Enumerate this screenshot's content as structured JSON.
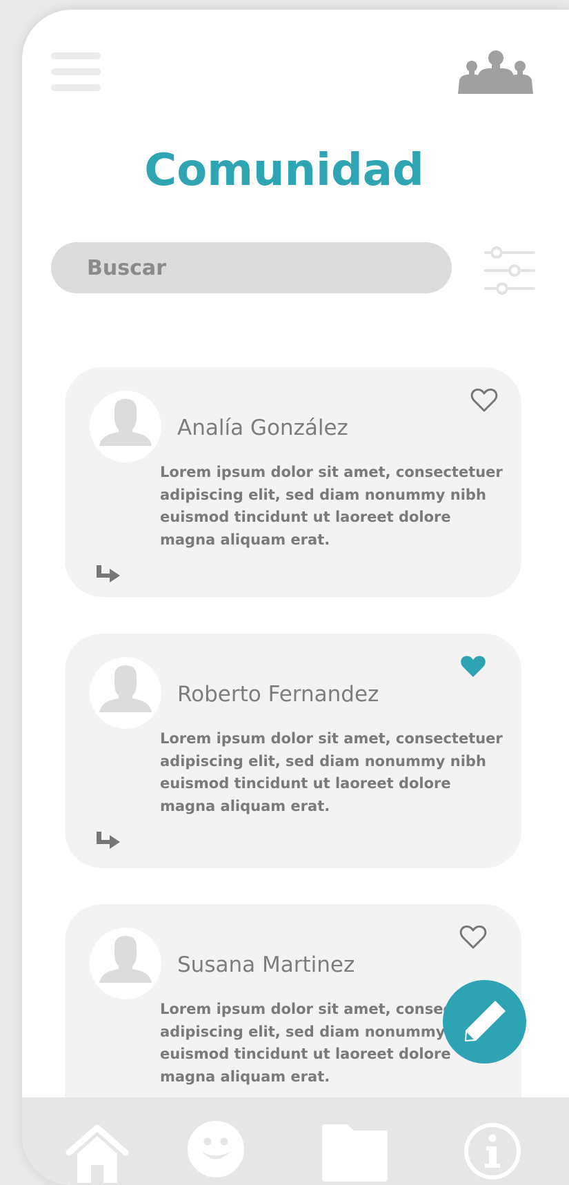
{
  "header": {
    "title": "Comunidad"
  },
  "search": {
    "placeholder": "Buscar"
  },
  "posts": [
    {
      "author": "Analía González",
      "body": "Lorem ipsum dolor sit amet, consectetuer adipiscing elit, sed diam nonummy nibh euismod tincidunt ut laoreet dolore magna aliquam erat.",
      "liked": false
    },
    {
      "author": "Roberto Fernandez",
      "body": "Lorem ipsum dolor sit amet, consectetuer adipiscing elit, sed diam nonummy nibh euismod tincidunt ut laoreet dolore magna aliquam erat.",
      "liked": true
    },
    {
      "author": "Susana Martinez",
      "body": "Lorem ipsum dolor sit amet, consectetuer adipiscing elit, sed diam nonummy nibh euismod tincidunt ut laoreet dolore magna aliquam erat.",
      "liked": false
    }
  ],
  "tabs": [
    {
      "icon": "home-icon"
    },
    {
      "icon": "smiley-icon"
    },
    {
      "icon": "folder-icon"
    },
    {
      "icon": "info-icon"
    }
  ],
  "fab": {
    "icon": "pencil-icon"
  },
  "colors": {
    "accent": "#2fa5b3",
    "card": "#f4f3f4",
    "tabbar": "#e6e6e6",
    "text_muted": "#7a7a7a",
    "search_bg": "#dcdcdc"
  }
}
